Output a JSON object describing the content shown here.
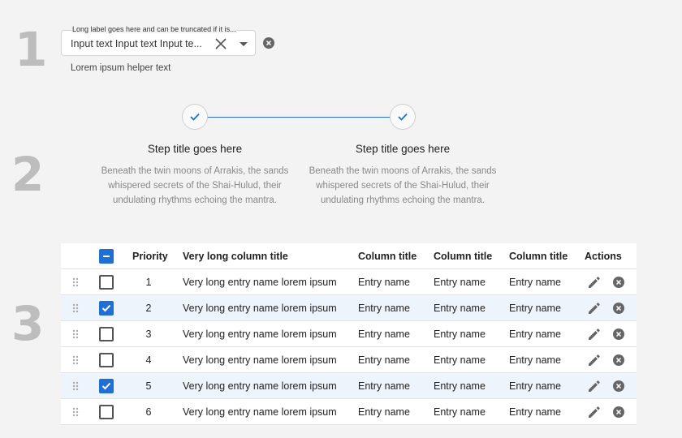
{
  "section_numbers": [
    "1",
    "2",
    "3"
  ],
  "input_field": {
    "label": "Long label goes here and can be truncated if it is...",
    "value": "Input text Input text Input te...",
    "helper": "Lorem ipsum helper text"
  },
  "steps": [
    {
      "title": "Step title goes here",
      "description": "Beneath the twin moons of Arrakis, the sands whispered secrets of the Shai-Hulud, their undulating rhythms echoing the mantra."
    },
    {
      "title": "Step title goes here",
      "description": "Beneath the twin moons of Arrakis, the sands whispered secrets of the Shai-Hulud, their undulating rhythms echoing the mantra."
    }
  ],
  "table": {
    "headers": {
      "priority": "Priority",
      "long": "Very long column title",
      "col1": "Column title",
      "col2": "Column title",
      "col3": "Column title",
      "actions": "Actions"
    },
    "rows": [
      {
        "priority": "1",
        "long": "Very long entry name lorem ipsum",
        "col1": "Entry name",
        "col2": "Entry name",
        "col3": "Entry name",
        "checked": false
      },
      {
        "priority": "2",
        "long": "Very long entry name lorem ipsum",
        "col1": "Entry name",
        "col2": "Entry name",
        "col3": "Entry name",
        "checked": true
      },
      {
        "priority": "3",
        "long": "Very long entry name lorem ipsum",
        "col1": "Entry name",
        "col2": "Entry name",
        "col3": "Entry name",
        "checked": false
      },
      {
        "priority": "4",
        "long": "Very long entry name lorem ipsum",
        "col1": "Entry name",
        "col2": "Entry name",
        "col3": "Entry name",
        "checked": false
      },
      {
        "priority": "5",
        "long": "Very long entry name lorem ipsum",
        "col1": "Entry name",
        "col2": "Entry name",
        "col3": "Entry name",
        "checked": true
      },
      {
        "priority": "6",
        "long": "Very long entry name lorem ipsum",
        "col1": "Entry name",
        "col2": "Entry name",
        "col3": "Entry name",
        "checked": false
      }
    ]
  },
  "icons": {
    "clear": "close-icon",
    "dropdown": "caret-down-icon",
    "outer_clear": "close-circle-icon",
    "step_check": "checkmark-icon",
    "drag": "drag-handle-icon",
    "edit": "pencil-icon",
    "delete": "close-circle-icon"
  },
  "colors": {
    "accent": "#1f6fd6",
    "selected_row": "#eef4fc",
    "section_number": "#bdbdbd"
  }
}
